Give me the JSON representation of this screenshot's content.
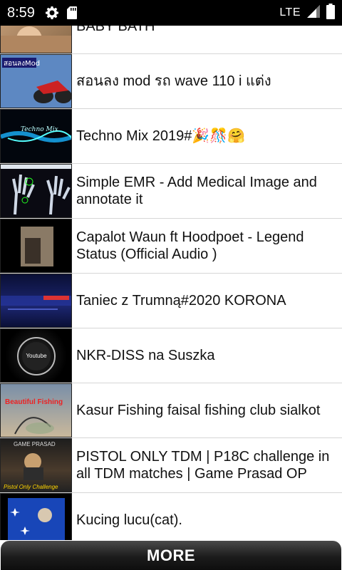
{
  "status_bar": {
    "time": "8:59",
    "icons": [
      "gear-icon",
      "sd-card-icon"
    ],
    "network": "LTE",
    "right_icons": [
      "signal-icon",
      "battery-icon"
    ]
  },
  "items": [
    {
      "title": "BABY BATH",
      "thumb": "baby-bath-thumbnail"
    },
    {
      "title": "สอนลง mod รถ wave 110 i แต่ง",
      "thumb": "motorbike-mod-thumbnail"
    },
    {
      "title": "Techno Mix 2019#🎉🎊🤗",
      "thumb": "techno-mix-thumbnail"
    },
    {
      "title": "Simple EMR - Add Medical Image and annotate it",
      "thumb": "xray-hands-thumbnail"
    },
    {
      "title": "Capalot Waun ft Hoodpoet - Legend Status (Official Audio )",
      "thumb": "capalot-thumbnail"
    },
    {
      "title": "Taniec z Trumną#2020 KORONA",
      "thumb": "taniec-thumbnail"
    },
    {
      "title": "NKR-DISS na Suszka",
      "thumb": "nkr-diss-thumbnail"
    },
    {
      "title": "Kasur Fishing faisal fishing club sialkot",
      "thumb": "fishing-thumbnail"
    },
    {
      "title": "PISTOL ONLY TDM | P18C challenge in all TDM matches | Game Prasad OP",
      "thumb": "pistol-tdm-thumbnail"
    },
    {
      "title": "Kucing lucu(cat).",
      "thumb": "cat-thumbnail"
    }
  ],
  "thumb_text": {
    "mod": "สอนลงMod",
    "techno": "Techno Mix",
    "nkr": "Youtube",
    "kasur": "Beautiful Fishing",
    "pistol_top": "GAME PRASAD",
    "pistol_bottom": "Pistol Only Challenge"
  },
  "more_button": {
    "label": "MORE"
  }
}
